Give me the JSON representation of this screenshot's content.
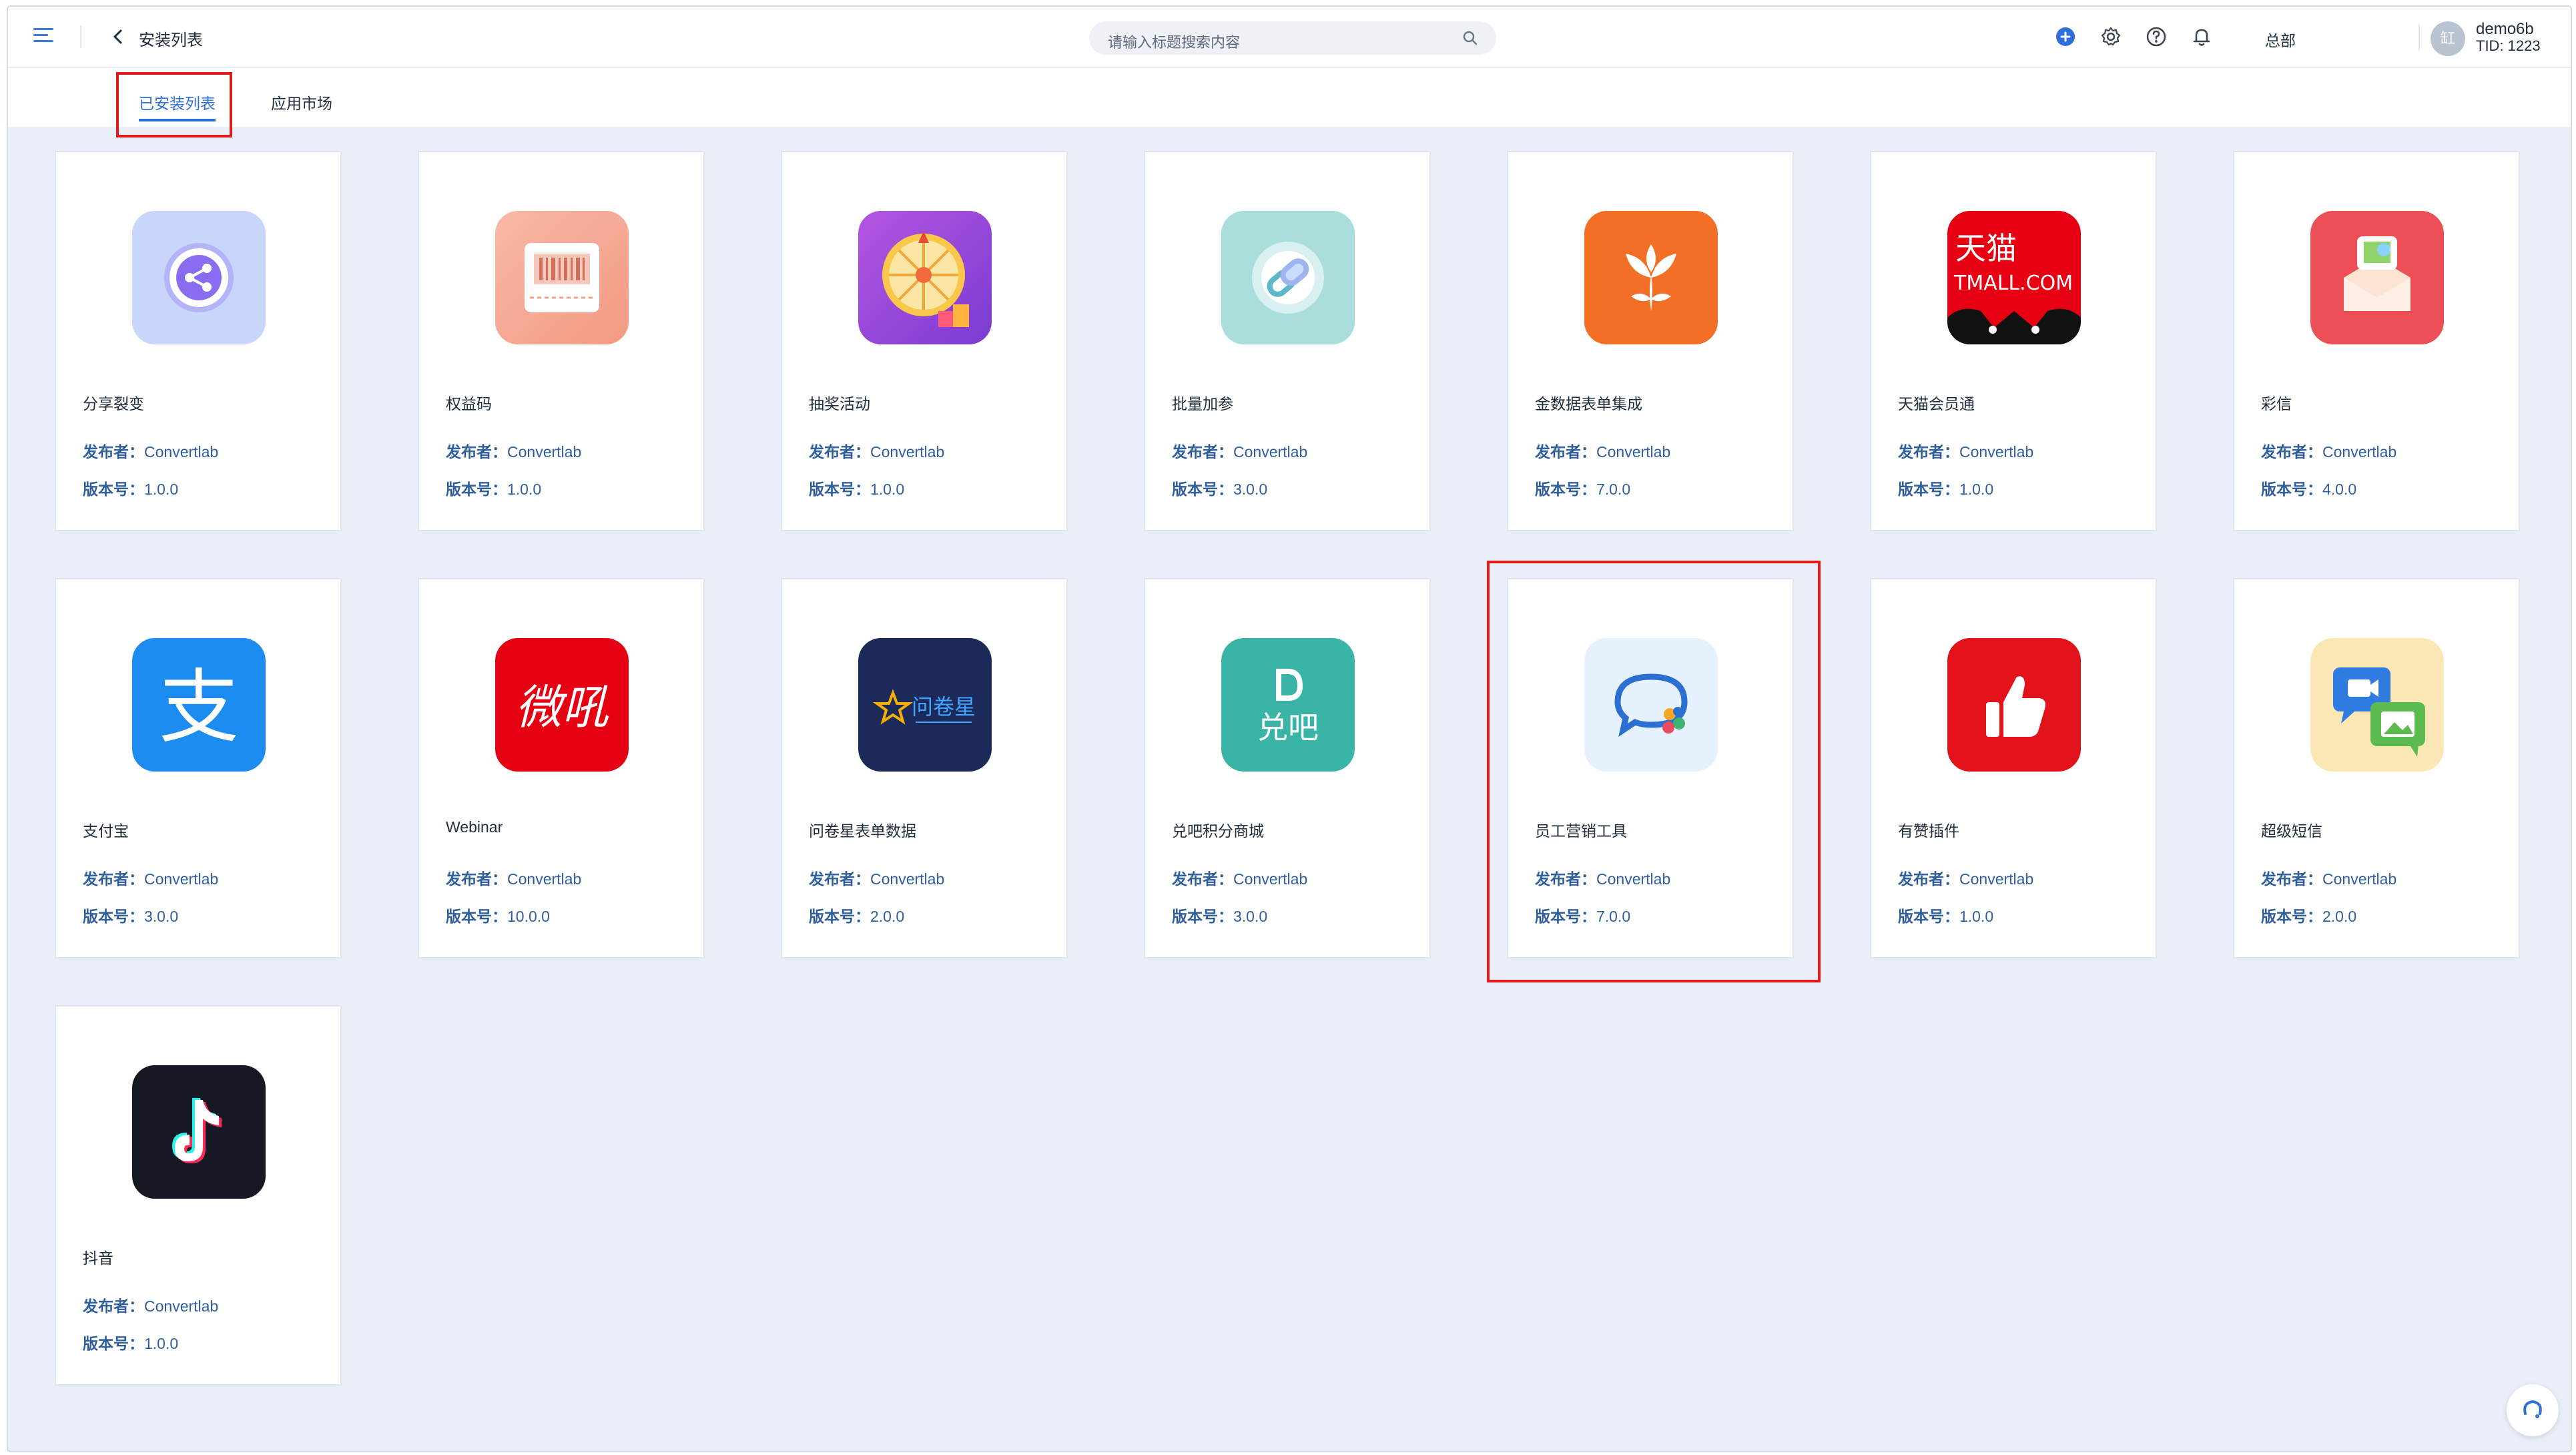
{
  "header": {
    "title": "安装列表",
    "search_placeholder": "请输入标题搜索内容",
    "org": "总部",
    "user": {
      "name": "demo6b",
      "tid": "TID: 1223",
      "avatar_text": "缸"
    },
    "accent": "#2f6fd9"
  },
  "tabs": [
    {
      "label": "已安装列表",
      "active": true
    },
    {
      "label": "应用市场",
      "active": false
    }
  ],
  "meta_labels": {
    "publisher": "发布者：",
    "version": "版本号："
  },
  "apps": [
    {
      "name": "分享裂变",
      "publisher": "Convertlab",
      "version": "1.0.0",
      "icon": "share-icon"
    },
    {
      "name": "权益码",
      "publisher": "Convertlab",
      "version": "1.0.0",
      "icon": "barcode-icon"
    },
    {
      "name": "抽奖活动",
      "publisher": "Convertlab",
      "version": "1.0.0",
      "icon": "lottery-wheel-icon"
    },
    {
      "name": "批量加参",
      "publisher": "Convertlab",
      "version": "3.0.0",
      "icon": "link-icon"
    },
    {
      "name": "金数据表单集成",
      "publisher": "Convertlab",
      "version": "7.0.0",
      "icon": "jinshuju-icon"
    },
    {
      "name": "天猫会员通",
      "publisher": "Convertlab",
      "version": "1.0.0",
      "icon": "tmall-icon",
      "icon_text_1": "天猫",
      "icon_text_2": "TMALL.COM"
    },
    {
      "name": "彩信",
      "publisher": "Convertlab",
      "version": "4.0.0",
      "icon": "mms-envelope-icon"
    },
    {
      "name": "支付宝",
      "publisher": "Convertlab",
      "version": "3.0.0",
      "icon": "alipay-icon",
      "icon_text_1": "支"
    },
    {
      "name": "Webinar",
      "publisher": "Convertlab",
      "version": "10.0.0",
      "icon": "weiniu-icon",
      "icon_text_1": "微吼"
    },
    {
      "name": "问卷星表单数据",
      "publisher": "Convertlab",
      "version": "2.0.0",
      "icon": "wjx-icon",
      "icon_text_1": "问卷星"
    },
    {
      "name": "兑吧积分商城",
      "publisher": "Convertlab",
      "version": "3.0.0",
      "icon": "duiba-icon",
      "icon_text_1": "兑吧"
    },
    {
      "name": "员工营销工具",
      "publisher": "Convertlab",
      "version": "7.0.0",
      "icon": "chat-bubble-icon"
    },
    {
      "name": "有赞插件",
      "publisher": "Convertlab",
      "version": "1.0.0",
      "icon": "thumbs-up-icon"
    },
    {
      "name": "超级短信",
      "publisher": "Convertlab",
      "version": "2.0.0",
      "icon": "super-sms-icon"
    },
    {
      "name": "抖音",
      "publisher": "Convertlab",
      "version": "1.0.0",
      "icon": "douyin-icon"
    }
  ]
}
